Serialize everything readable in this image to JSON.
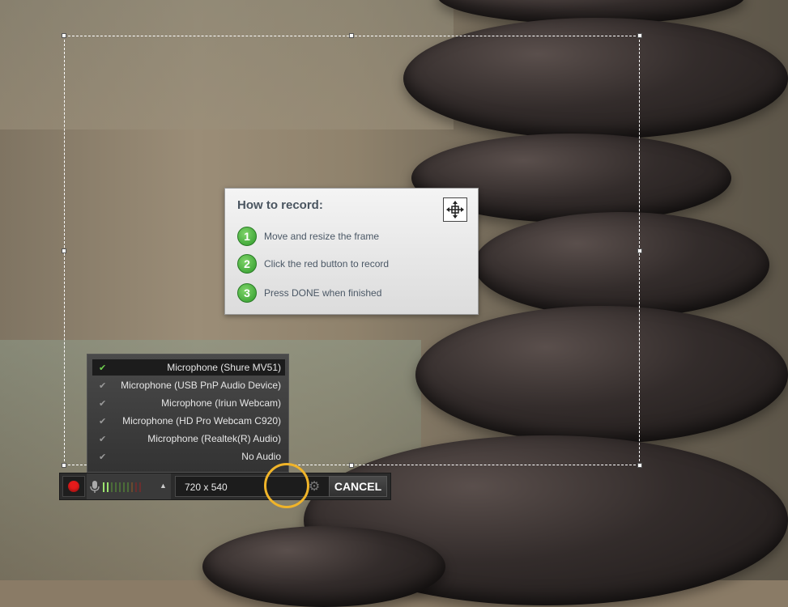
{
  "howto": {
    "title": "How to record:",
    "steps": [
      {
        "num": "1",
        "text": "Move and resize the frame"
      },
      {
        "num": "2",
        "text": "Click the red button to record"
      },
      {
        "num": "3",
        "text": "Press DONE when finished"
      }
    ]
  },
  "mic_menu": {
    "items": [
      {
        "label": "Microphone (Shure MV51)",
        "selected": true
      },
      {
        "label": "Microphone (USB PnP Audio Device)",
        "selected": false
      },
      {
        "label": "Microphone (Iriun Webcam)",
        "selected": false
      },
      {
        "label": "Microphone (HD Pro Webcam C920)",
        "selected": false
      },
      {
        "label": "Microphone (Realtek(R) Audio)",
        "selected": false
      },
      {
        "label": "No Audio",
        "selected": false
      }
    ]
  },
  "toolbar": {
    "resolution": "720 x 540",
    "cancel_label": "CANCEL",
    "record_color": "#e51b1b",
    "highlight_color": "#f0b429"
  }
}
